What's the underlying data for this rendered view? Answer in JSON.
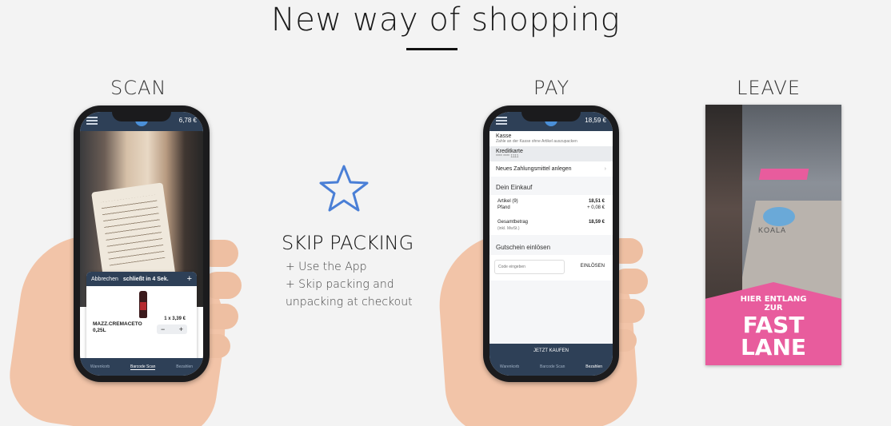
{
  "title": "New way of shopping",
  "columns": {
    "scan": "SCAN",
    "pay": "PAY",
    "leave": "LEAVE"
  },
  "middle": {
    "heading": "SKIP PACKING",
    "lines": [
      "+ Use the App",
      "+ Skip packing and",
      "unpacking at checkout"
    ],
    "icon": "star-outline-icon",
    "icon_color": "#4a7fd6"
  },
  "scan_phone": {
    "header_price": "6,78 €",
    "card": {
      "cancel": "Abbrechen",
      "timer": "schließt in 4 Sek.",
      "add": "+",
      "product_name": "MAZZ.CREMACETO 0,25L",
      "qty_price": "1 x 3,39 €",
      "minus": "−",
      "plus": "+"
    },
    "bottom_nav": [
      "Warenkorb",
      "Barcode Scan",
      "Bezahlen"
    ]
  },
  "pay_phone": {
    "header_price": "18,59 €",
    "kasse_title": "Kasse",
    "kasse_sub": "Zahle an der Kasse ohne Artikel auszupacken",
    "card_label": "Kreditkarte",
    "card_number": "**** **** 1111",
    "new_payment": "Neues Zahlungsmittel anlegen",
    "section_purchase": "Dein Einkauf",
    "rows": [
      {
        "label": "Artikel (9)",
        "value": "18,51 €"
      },
      {
        "label": "Pfand",
        "value": "+ 0,08 €"
      }
    ],
    "total_label": "Gesamtbetrag",
    "total_sub": "(inkl. MwSt.)",
    "total_value": "18,59 €",
    "voucher_section": "Gutschein einlösen",
    "voucher_placeholder": "Code eingeben",
    "voucher_button": "EINLÖSEN",
    "buy_button": "JETZT KAUFEN",
    "bottom_nav": [
      "Warenkorb",
      "Barcode Scan",
      "Bezahlen"
    ]
  },
  "leave_photo": {
    "sign_small": "HIER ENTLANG ZUR",
    "sign_big_1": "FAST",
    "sign_big_2": "LANE",
    "floor_text": "KOALA",
    "pink_color": "#e85c9d"
  }
}
